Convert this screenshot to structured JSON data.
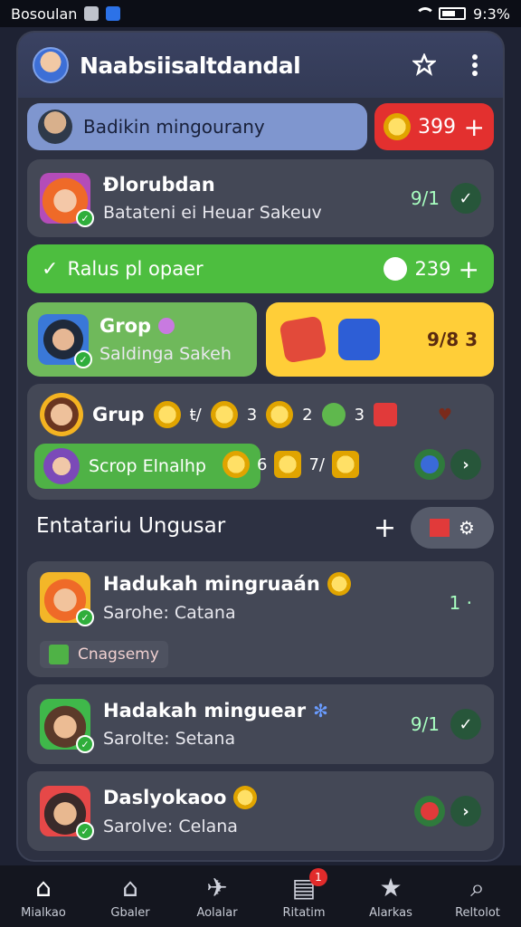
{
  "status_bar": {
    "carrier": "Bosoulan",
    "battery": "9:3%"
  },
  "header": {
    "title": "Naabsiisaltdandal"
  },
  "profile": {
    "name": "Badikin mingourany"
  },
  "coins": {
    "value": "399",
    "add": "+"
  },
  "featured": {
    "title": "Đlorubdan",
    "subtitle": "Batateni ei Heuar Sakeuv",
    "count": "9/1"
  },
  "green_bar": {
    "label": "Ralus pl opaer",
    "value": "239",
    "add": "+"
  },
  "group_card": {
    "label": "Grop",
    "subtitle": "Saldinga Sakeh"
  },
  "yellow_card": {
    "value": "9/8 3"
  },
  "group_row": {
    "label": "Grup",
    "items": [
      "ŧ/",
      "3",
      "2",
      "3"
    ],
    "sub_label": "Scrop Elnalhp",
    "sub_items": [
      "6",
      "7/"
    ]
  },
  "section": {
    "title": "Entatariu Ungusar",
    "add": "+"
  },
  "list_items": [
    {
      "title": "Hadukah mingruaán",
      "subtitle": "Sarohe: Catana",
      "count": "1 ·",
      "tag": "Cnagsemy"
    },
    {
      "title": "Hadakah minguear",
      "subtitle": "Sarolte: Setana",
      "count": "9/1"
    },
    {
      "title": "Daslyokaoo",
      "subtitle": "Sarolve: Celana",
      "count": ""
    }
  ],
  "bottom_nav": [
    {
      "label": "Mialkao",
      "icon": "home-icon",
      "glyph": "⌂"
    },
    {
      "label": "Gbaler",
      "icon": "house-outline-icon",
      "glyph": "⌂"
    },
    {
      "label": "Aolalar",
      "icon": "bird-icon",
      "glyph": "✈"
    },
    {
      "label": "Ritatim",
      "icon": "calendar-icon",
      "glyph": "▤",
      "badge": "1"
    },
    {
      "label": "Alarkas",
      "icon": "star-icon",
      "glyph": "★"
    },
    {
      "label": "Reltolot",
      "icon": "search-icon",
      "glyph": "⌕"
    }
  ]
}
